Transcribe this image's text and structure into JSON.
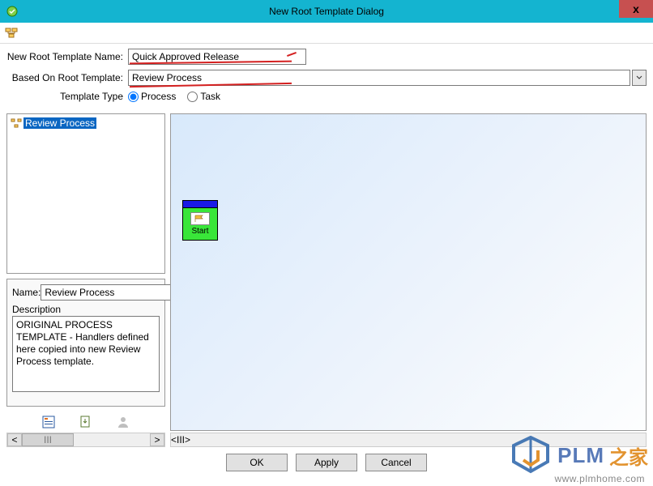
{
  "window": {
    "title": "New Root Template Dialog",
    "close_glyph": "x"
  },
  "form": {
    "name_label": "New Root Template Name:",
    "name_value": "Quick Approved Release",
    "based_label": "Based On Root Template:",
    "based_value": "Review Process",
    "type_label": "Template Type",
    "radio_process": "Process",
    "radio_task": "Task"
  },
  "tree": {
    "root_label": "Review Process"
  },
  "details": {
    "name_label": "Name:",
    "name_value": "Review Process",
    "desc_label": "Description",
    "desc_value": "ORIGINAL PROCESS TEMPLATE - Handlers defined here copied into new Review Process template."
  },
  "canvas": {
    "node_label": "Start"
  },
  "scroll": {
    "thumb_glyph": "III",
    "left_glyph": "<",
    "right_glyph": ">"
  },
  "buttons": {
    "ok": "OK",
    "apply": "Apply",
    "cancel": "Cancel"
  },
  "watermark": {
    "brand": "PLM",
    "cn": "之家",
    "url": "www.plmhome.com"
  }
}
